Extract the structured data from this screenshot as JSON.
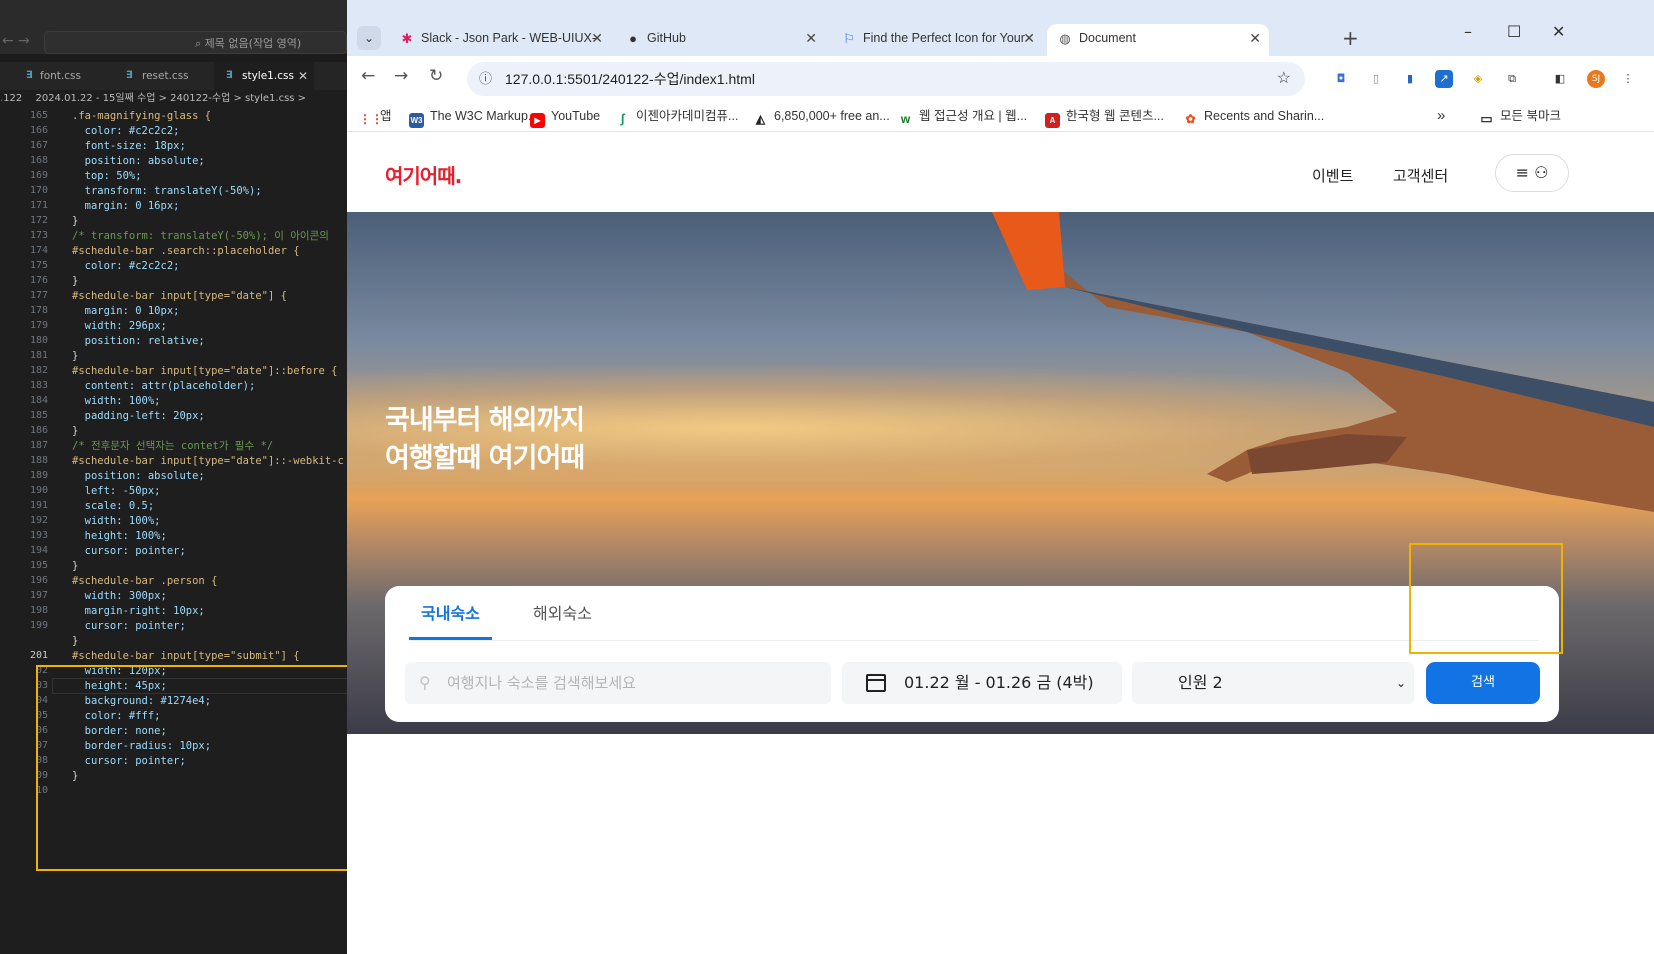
{
  "editor": {
    "search_placeholder": "제목 없음(작업 영역)",
    "tabs": [
      {
        "label": "font.css"
      },
      {
        "label": "reset.css"
      },
      {
        "label": "style1.css"
      }
    ],
    "breadcrumb": "2024.01.22 - 15일째 수업 > 240122-수업 > style1.css > ",
    "line_partial_top": "122",
    "lines": [
      {
        "n": "165",
        "t": ".fa-magnifying-glass {"
      },
      {
        "n": "166",
        "t": "  color: #c2c2c2;"
      },
      {
        "n": "167",
        "t": "  font-size: 18px;"
      },
      {
        "n": "168",
        "t": "  position: absolute;"
      },
      {
        "n": "169",
        "t": "  top: 50%;"
      },
      {
        "n": "170",
        "t": "  transform: translateY(-50%);"
      },
      {
        "n": "171",
        "t": "  margin: 0 16px;"
      },
      {
        "n": "172",
        "t": "}"
      },
      {
        "n": "173",
        "t": "/* transform: translateY(-50%); 이 아이콘의"
      },
      {
        "n": "174",
        "t": "#schedule-bar .search::placeholder {"
      },
      {
        "n": "175",
        "t": "  color: #c2c2c2;"
      },
      {
        "n": "176",
        "t": "}"
      },
      {
        "n": "177",
        "t": "#schedule-bar input[type=\"date\"] {"
      },
      {
        "n": "178",
        "t": "  margin: 0 10px;"
      },
      {
        "n": "179",
        "t": "  width: 296px;"
      },
      {
        "n": "180",
        "t": "  position: relative;"
      },
      {
        "n": "181",
        "t": "}"
      },
      {
        "n": "182",
        "t": "#schedule-bar input[type=\"date\"]::before {"
      },
      {
        "n": "183",
        "t": "  content: attr(placeholder);"
      },
      {
        "n": "184",
        "t": "  width: 100%;"
      },
      {
        "n": "185",
        "t": "  padding-left: 20px;"
      },
      {
        "n": "186",
        "t": "}"
      },
      {
        "n": "187",
        "t": "/* 전후문자 선택자는 contet가 필수 */"
      },
      {
        "n": "188",
        "t": "#schedule-bar input[type=\"date\"]::-webkit-c"
      },
      {
        "n": "189",
        "t": "  position: absolute;"
      },
      {
        "n": "190",
        "t": "  left: -50px;"
      },
      {
        "n": "191",
        "t": "  scale: 0.5;"
      },
      {
        "n": "192",
        "t": "  width: 100%;"
      },
      {
        "n": "193",
        "t": "  height: 100%;"
      },
      {
        "n": "194",
        "t": "  cursor: pointer;"
      },
      {
        "n": "195",
        "t": "}"
      },
      {
        "n": "196",
        "t": "#schedule-bar .person {"
      },
      {
        "n": "197",
        "t": "  width: 300px;"
      },
      {
        "n": "198",
        "t": "  margin-right: 10px;"
      },
      {
        "n": "199",
        "t": "  cursor: pointer;"
      },
      {
        "n": "",
        "t": "}"
      },
      {
        "n": "201",
        "t": "#schedule-bar input[type=\"submit\"] {"
      },
      {
        "n": "02",
        "t": "  width: 120px;"
      },
      {
        "n": "03",
        "t": "  height: 45px;"
      },
      {
        "n": "04",
        "t": "  background: #1274e4;"
      },
      {
        "n": "05",
        "t": "  color: #fff;"
      },
      {
        "n": "06",
        "t": "  border: none;"
      },
      {
        "n": "07",
        "t": "  border-radius: 10px;"
      },
      {
        "n": "08",
        "t": "  cursor: pointer;"
      },
      {
        "n": "09",
        "t": "}"
      },
      {
        "n": "10",
        "t": ""
      }
    ]
  },
  "browser": {
    "tabs": [
      {
        "label": "Slack - Json Park - WEB-UIUX-",
        "icon": "slack-icon"
      },
      {
        "label": "GitHub",
        "icon": "github-icon"
      },
      {
        "label": "Find the Perfect Icon for Your",
        "icon": "flag-icon"
      },
      {
        "label": "Document",
        "icon": "globe-icon"
      }
    ],
    "url": "127.0.0.1:5501/240122-수업/index1.html",
    "profile": "SJ",
    "bookmarks": [
      {
        "label": "앱"
      },
      {
        "label": "The W3C Markup..."
      },
      {
        "label": "YouTube"
      },
      {
        "label": "이젠아카데미컴퓨..."
      },
      {
        "label": "6,850,000+ free an..."
      },
      {
        "label": "웹 접근성 개요 | 웹..."
      },
      {
        "label": "한국형 웹 콘텐츠..."
      },
      {
        "label": "Recents and Sharin..."
      }
    ],
    "more": "»",
    "all_bookmarks": "모든 북마크"
  },
  "site": {
    "logo": "여기어때.",
    "menu": [
      {
        "label": "이벤트"
      },
      {
        "label": "고객센터"
      }
    ],
    "hero_line1": "국내부터 해외까지",
    "hero_line2": "여행할때 여기어때",
    "tabs": [
      {
        "label": "국내숙소"
      },
      {
        "label": "해외숙소"
      }
    ],
    "search_placeholder": "여행지나 숙소를 검색해보세요",
    "date": "01.22 월 - 01.26 금 (4박)",
    "person": "인원 2",
    "submit": "검색"
  },
  "colors": {
    "accent": "#1274e4",
    "brand": "#e8202e",
    "highlight": "#f0b400"
  }
}
